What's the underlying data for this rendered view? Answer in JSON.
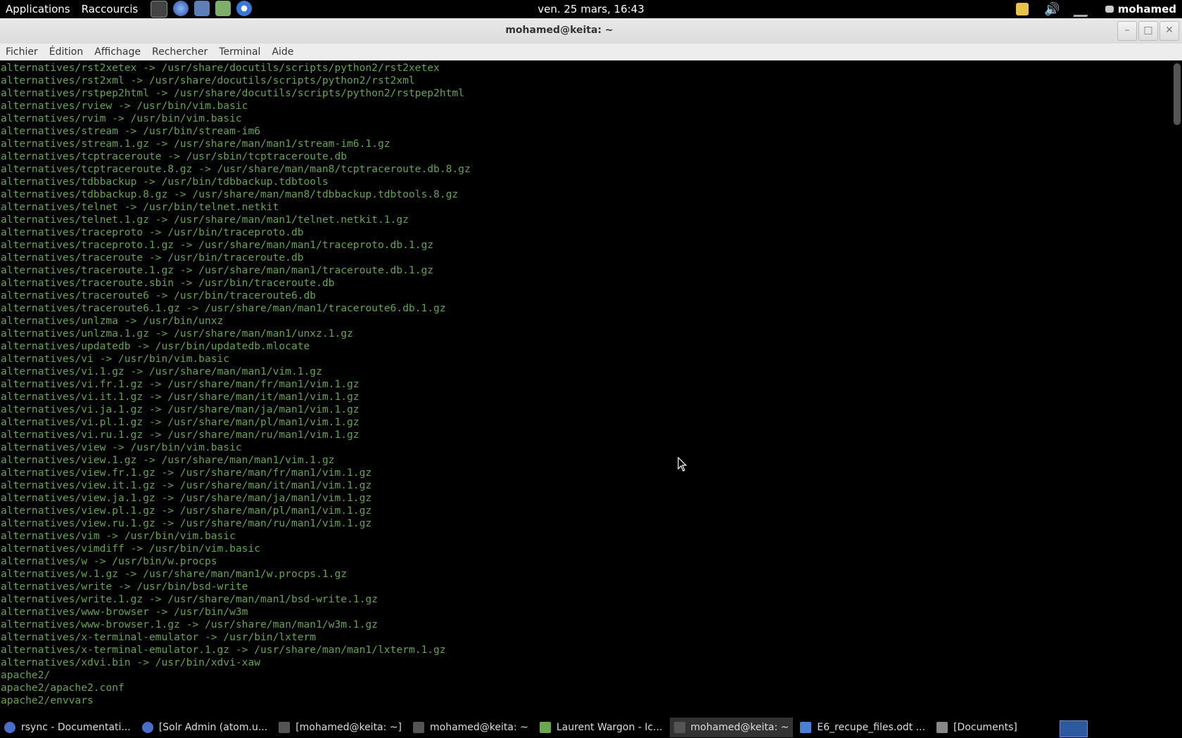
{
  "top_panel": {
    "applications": "Applications",
    "shortcuts": "Raccourcis",
    "clock": "ven. 25 mars, 16:43",
    "user": "mohamed",
    "launchers": [
      "terminal-icon",
      "firefox-icon",
      "virtualbox-icon",
      "image-viewer-icon",
      "chromium-icon"
    ]
  },
  "window": {
    "title": "mohamed@keita: ~"
  },
  "menubar": {
    "items": [
      "Fichier",
      "Édition",
      "Affichage",
      "Rechercher",
      "Terminal",
      "Aide"
    ]
  },
  "terminal": {
    "text_color": "#66a34f",
    "lines": [
      "alternatives/rst2xetex -> /usr/share/docutils/scripts/python2/rst2xetex",
      "alternatives/rst2xml -> /usr/share/docutils/scripts/python2/rst2xml",
      "alternatives/rstpep2html -> /usr/share/docutils/scripts/python2/rstpep2html",
      "alternatives/rview -> /usr/bin/vim.basic",
      "alternatives/rvim -> /usr/bin/vim.basic",
      "alternatives/stream -> /usr/bin/stream-im6",
      "alternatives/stream.1.gz -> /usr/share/man/man1/stream-im6.1.gz",
      "alternatives/tcptraceroute -> /usr/sbin/tcptraceroute.db",
      "alternatives/tcptraceroute.8.gz -> /usr/share/man/man8/tcptraceroute.db.8.gz",
      "alternatives/tdbbackup -> /usr/bin/tdbbackup.tdbtools",
      "alternatives/tdbbackup.8.gz -> /usr/share/man/man8/tdbbackup.tdbtools.8.gz",
      "alternatives/telnet -> /usr/bin/telnet.netkit",
      "alternatives/telnet.1.gz -> /usr/share/man/man1/telnet.netkit.1.gz",
      "alternatives/traceproto -> /usr/bin/traceproto.db",
      "alternatives/traceproto.1.gz -> /usr/share/man/man1/traceproto.db.1.gz",
      "alternatives/traceroute -> /usr/bin/traceroute.db",
      "alternatives/traceroute.1.gz -> /usr/share/man/man1/traceroute.db.1.gz",
      "alternatives/traceroute.sbin -> /usr/bin/traceroute.db",
      "alternatives/traceroute6 -> /usr/bin/traceroute6.db",
      "alternatives/traceroute6.1.gz -> /usr/share/man/man1/traceroute6.db.1.gz",
      "alternatives/unlzma -> /usr/bin/unxz",
      "alternatives/unlzma.1.gz -> /usr/share/man/man1/unxz.1.gz",
      "alternatives/updatedb -> /usr/bin/updatedb.mlocate",
      "alternatives/vi -> /usr/bin/vim.basic",
      "alternatives/vi.1.gz -> /usr/share/man/man1/vim.1.gz",
      "alternatives/vi.fr.1.gz -> /usr/share/man/fr/man1/vim.1.gz",
      "alternatives/vi.it.1.gz -> /usr/share/man/it/man1/vim.1.gz",
      "alternatives/vi.ja.1.gz -> /usr/share/man/ja/man1/vim.1.gz",
      "alternatives/vi.pl.1.gz -> /usr/share/man/pl/man1/vim.1.gz",
      "alternatives/vi.ru.1.gz -> /usr/share/man/ru/man1/vim.1.gz",
      "alternatives/view -> /usr/bin/vim.basic",
      "alternatives/view.1.gz -> /usr/share/man/man1/vim.1.gz",
      "alternatives/view.fr.1.gz -> /usr/share/man/fr/man1/vim.1.gz",
      "alternatives/view.it.1.gz -> /usr/share/man/it/man1/vim.1.gz",
      "alternatives/view.ja.1.gz -> /usr/share/man/ja/man1/vim.1.gz",
      "alternatives/view.pl.1.gz -> /usr/share/man/pl/man1/vim.1.gz",
      "alternatives/view.ru.1.gz -> /usr/share/man/ru/man1/vim.1.gz",
      "alternatives/vim -> /usr/bin/vim.basic",
      "alternatives/vimdiff -> /usr/bin/vim.basic",
      "alternatives/w -> /usr/bin/w.procps",
      "alternatives/w.1.gz -> /usr/share/man/man1/w.procps.1.gz",
      "alternatives/write -> /usr/bin/bsd-write",
      "alternatives/write.1.gz -> /usr/share/man/man1/bsd-write.1.gz",
      "alternatives/www-browser -> /usr/bin/w3m",
      "alternatives/www-browser.1.gz -> /usr/share/man/man1/w3m.1.gz",
      "alternatives/x-terminal-emulator -> /usr/bin/lxterm",
      "alternatives/x-terminal-emulator.1.gz -> /usr/share/man/man1/lxterm.1.gz",
      "alternatives/xdvi.bin -> /usr/bin/xdvi-xaw",
      "apache2/",
      "apache2/apache2.conf",
      "apache2/envvars"
    ]
  },
  "taskbar": {
    "tasks": [
      {
        "label": "rsync - Documentati...",
        "icon": "firefox-icon",
        "active": false
      },
      {
        "label": "[Solr Admin (atom.u...",
        "icon": "firefox-icon",
        "active": false
      },
      {
        "label": "[mohamed@keita: ~]",
        "icon": "terminal-icon",
        "active": false
      },
      {
        "label": "mohamed@keita: ~",
        "icon": "terminal-icon",
        "active": false
      },
      {
        "label": "Laurent Wargon - Ic...",
        "icon": "image-viewer-icon",
        "active": false
      },
      {
        "label": "mohamed@keita: ~",
        "icon": "terminal-icon",
        "active": true
      },
      {
        "label": "E6_recupe_files.odt ...",
        "icon": "document-icon",
        "active": false
      },
      {
        "label": "[Documents]",
        "icon": "folder-icon",
        "active": false
      }
    ]
  }
}
